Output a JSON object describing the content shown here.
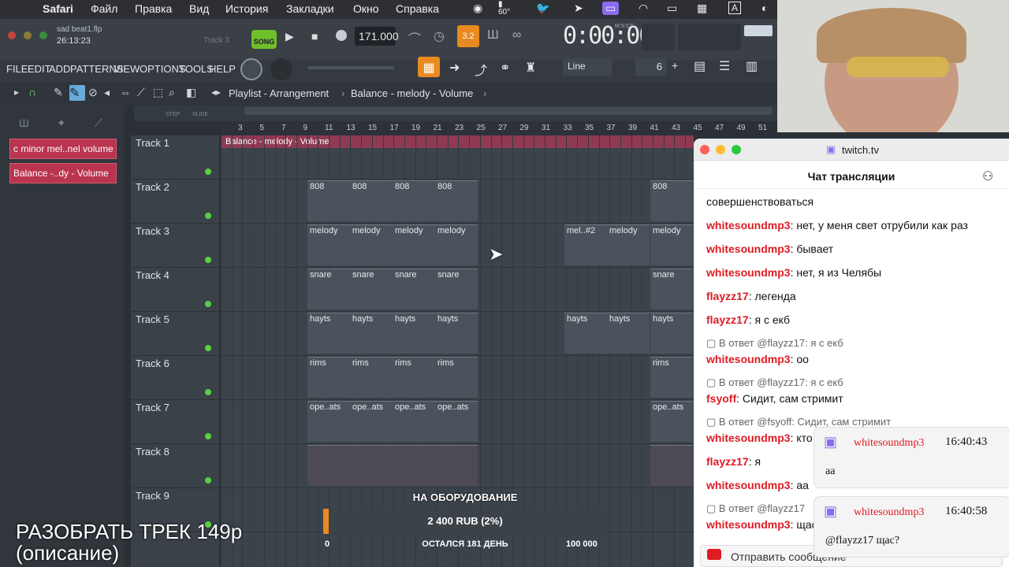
{
  "menubar": {
    "app": "Safari",
    "items": [
      "Файл",
      "Правка",
      "Вид",
      "История",
      "Закладки",
      "Окно",
      "Справка"
    ],
    "temp": "60°",
    "icon_names": [
      "apple-icon",
      "ai-icon",
      "temperature-icon",
      "bird-icon",
      "cursor-icon",
      "screen-icon",
      "wifi-icon",
      "display-icon",
      "keyboard-icon",
      "input-a-icon",
      "twitch-icon"
    ]
  },
  "fl": {
    "file": "sad beat1.flp",
    "time_small": "26:13:23",
    "track_hint": "Track 3",
    "song_label": "SONG",
    "tempo": "171.000",
    "counter": "0:00:00",
    "counter_label": "M:S:CS",
    "menu": [
      "FILE",
      "EDIT",
      "ADD",
      "PATTERNS",
      "VIEW",
      "OPTIONS",
      "TOOLS",
      "HELP"
    ],
    "snap": "Line",
    "step_value": "6",
    "breadcrumb": [
      "Playlist - Arrangement",
      "Balance - melody - Volume"
    ],
    "step_label": "STEP",
    "slide_label": "SLIDE",
    "ruler": [
      "3",
      "5",
      "7",
      "9",
      "11",
      "13",
      "15",
      "17",
      "19",
      "21",
      "23",
      "25",
      "27",
      "29",
      "31",
      "33",
      "35",
      "37",
      "39",
      "41",
      "43",
      "45",
      "47",
      "49",
      "51"
    ],
    "auto_clips": [
      "c minor mel..nel volume",
      "Balance -..dy - Volume"
    ],
    "auto_strip": "Balance - melody - Volume",
    "tracks": [
      "Track 1",
      "Track 2",
      "Track 3",
      "Track 4",
      "Track 5",
      "Track 6",
      "Track 7",
      "Track 8",
      "Track 9"
    ],
    "clips": {
      "t2": [
        "808",
        "808",
        "808",
        "808",
        "808"
      ],
      "t3": [
        "melody",
        "melody",
        "melody",
        "melody",
        "mel..#2",
        "melody",
        "melody"
      ],
      "t4": [
        "snare",
        "snare",
        "snare",
        "snare",
        "snare"
      ],
      "t5": [
        "hayts",
        "hayts",
        "hayts",
        "hayts",
        "hayts",
        "hayts",
        "hayts"
      ],
      "t6": [
        "rims",
        "rims",
        "rims",
        "rims",
        "rims"
      ],
      "t7": [
        "ope..ats",
        "ope..ats",
        "ope..ats",
        "ope..ats",
        "ope..ats"
      ]
    },
    "colors": {
      "automation": "#b9344f",
      "led": "#58d040",
      "accent_orange": "#e88a20"
    }
  },
  "chat": {
    "site": "twitch.tv",
    "title": "Чат трансляции",
    "messages": [
      {
        "user": "",
        "text": "совершенствоваться"
      },
      {
        "user": "whitesoundmp3",
        "text": ": нет, у меня свет отрубили как раз"
      },
      {
        "user": "whitesoundmp3",
        "text": ": бывает"
      },
      {
        "user": "whitesoundmp3",
        "text": ": нет, я из Челябы"
      },
      {
        "user": "flayzz17",
        "text": ": легенда"
      },
      {
        "user": "flayzz17",
        "text": ": я с екб"
      },
      {
        "reply": "В ответ @flayzz17: я с екб",
        "user": "whitesoundmp3",
        "text": ": оо"
      },
      {
        "reply": "В ответ @flayzz17: я с екб",
        "user": "fsyoff",
        "text": ": Сидит, сам стримит"
      },
      {
        "reply": "В ответ @fsyoff: Сидит, сам стримит",
        "user": "whitesoundmp3",
        "text": ": кто"
      },
      {
        "user": "flayzz17",
        "text": ": я"
      },
      {
        "user": "whitesoundmp3",
        "text": ": аа"
      },
      {
        "reply": "В ответ @flayzz17",
        "user": "whitesoundmp3",
        "text": ": щас"
      }
    ],
    "send": "Отправить сообщение",
    "notifications": [
      {
        "user": "whitesoundmp3",
        "time": "16:40:43",
        "text": "аа"
      },
      {
        "user": "whitesoundmp3",
        "time": "16:40:58",
        "text": "@flayzz17 щас?"
      }
    ]
  },
  "overlay": {
    "goal_title": "НА ОБОРУДОВАНИЕ",
    "goal_amount": "2 400 RUB (2%)",
    "goal_progress": 0.02,
    "goal_min": "0",
    "goal_left": "ОСТАЛСЯ 181 ДЕНЬ",
    "goal_max": "100 000",
    "promo_line1": "РАЗОБРАТЬ ТРЕК 149р",
    "promo_line2": "(описание)"
  }
}
